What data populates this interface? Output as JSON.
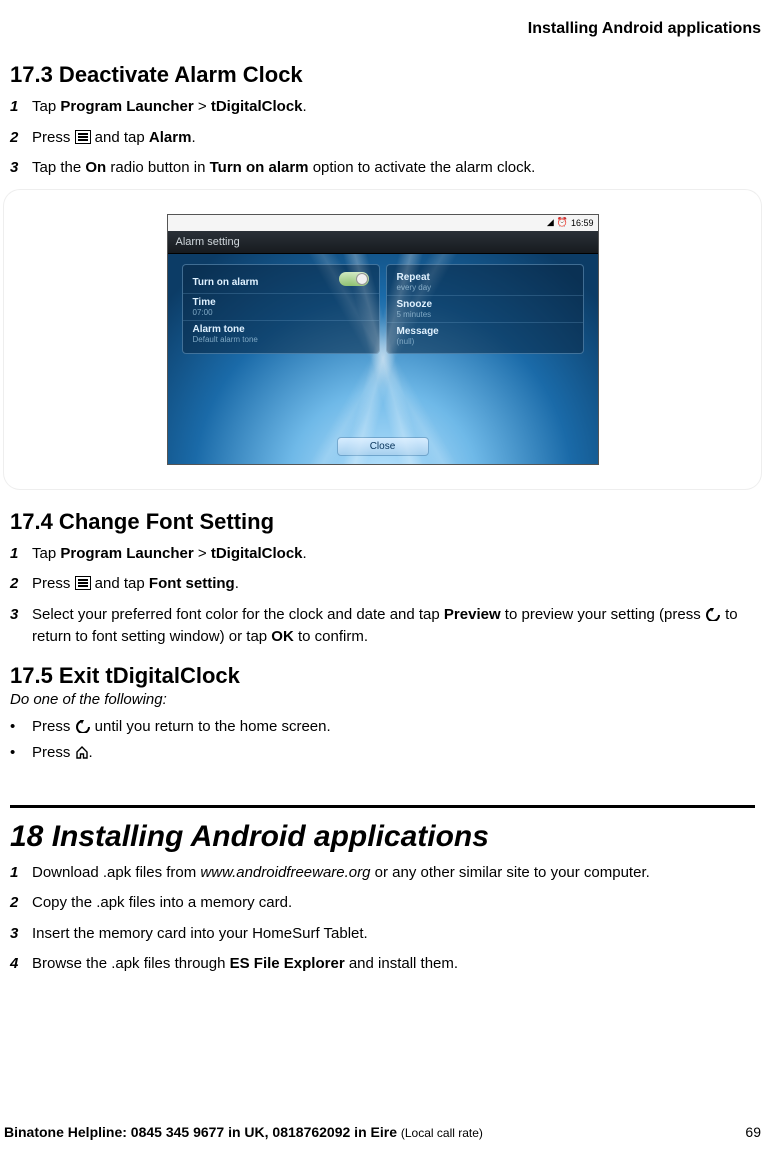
{
  "header": {
    "running_title": "Installing Android applications"
  },
  "s173": {
    "heading": "17.3  Deactivate Alarm Clock",
    "step1_a": "Tap ",
    "step1_b": "Program Launcher",
    "step1_c": " > ",
    "step1_d": "tDigitalClock",
    "step1_e": ".",
    "step2_a": "Press ",
    "step2_b": " and tap ",
    "step2_c": "Alarm",
    "step2_d": ".",
    "step3_a": "Tap the ",
    "step3_b": "On",
    "step3_c": " radio button in ",
    "step3_d": "Turn on alarm",
    "step3_e": " option to activate the alarm clock."
  },
  "device": {
    "time": "16:59",
    "title": "Alarm setting",
    "left": {
      "turn_on": {
        "label": "Turn on alarm",
        "toggle": "On"
      },
      "time": {
        "label": "Time",
        "sub": "07:00"
      },
      "tone": {
        "label": "Alarm tone",
        "sub": "Default alarm tone"
      }
    },
    "right": {
      "repeat": {
        "label": "Repeat",
        "sub": "every day"
      },
      "snooze": {
        "label": "Snooze",
        "sub": "5 minutes"
      },
      "message": {
        "label": "Message",
        "sub": "(null)"
      }
    },
    "close": "Close"
  },
  "s174": {
    "heading": "17.4  Change Font Setting",
    "step1_a": "Tap ",
    "step1_b": "Program Launcher",
    "step1_c": " > ",
    "step1_d": "tDigitalClock",
    "step1_e": ".",
    "step2_a": "Press ",
    "step2_b": " and tap ",
    "step2_c": "Font setting",
    "step2_d": ".",
    "step3_a": "Select your preferred font color for the clock and date and tap ",
    "step3_b": "Preview",
    "step3_c": " to preview your setting (press ",
    "step3_d": " to return to font setting window) or tap ",
    "step3_e": "OK",
    "step3_f": " to confirm."
  },
  "s175": {
    "heading": "17.5  Exit tDigitalClock",
    "intro": "Do one of the following:",
    "b1_a": "Press ",
    "b1_b": " until you return to the home screen.",
    "b2_a": "Press ",
    "b2_b": "."
  },
  "s18": {
    "heading": "18 Installing Android applications",
    "step1_a": "Download .apk files from ",
    "step1_b": "www.androidfreeware.org",
    "step1_c": " or any other similar site to your computer.",
    "step2": "Copy the .apk files into a memory card.",
    "step3": "Insert the memory card into your HomeSurf Tablet.",
    "step4_a": "Browse the .apk files through ",
    "step4_b": "ES File Explorer",
    "step4_c": " and install them."
  },
  "footer": {
    "left_bold": "Binatone Helpline: 0845 345 9677 in UK, 0818762092 in Eire ",
    "left_small": "(Local call rate)",
    "page": "69"
  },
  "nums": {
    "n1": "1",
    "n2": "2",
    "n3": "3",
    "n4": "4",
    "dot": "•"
  }
}
